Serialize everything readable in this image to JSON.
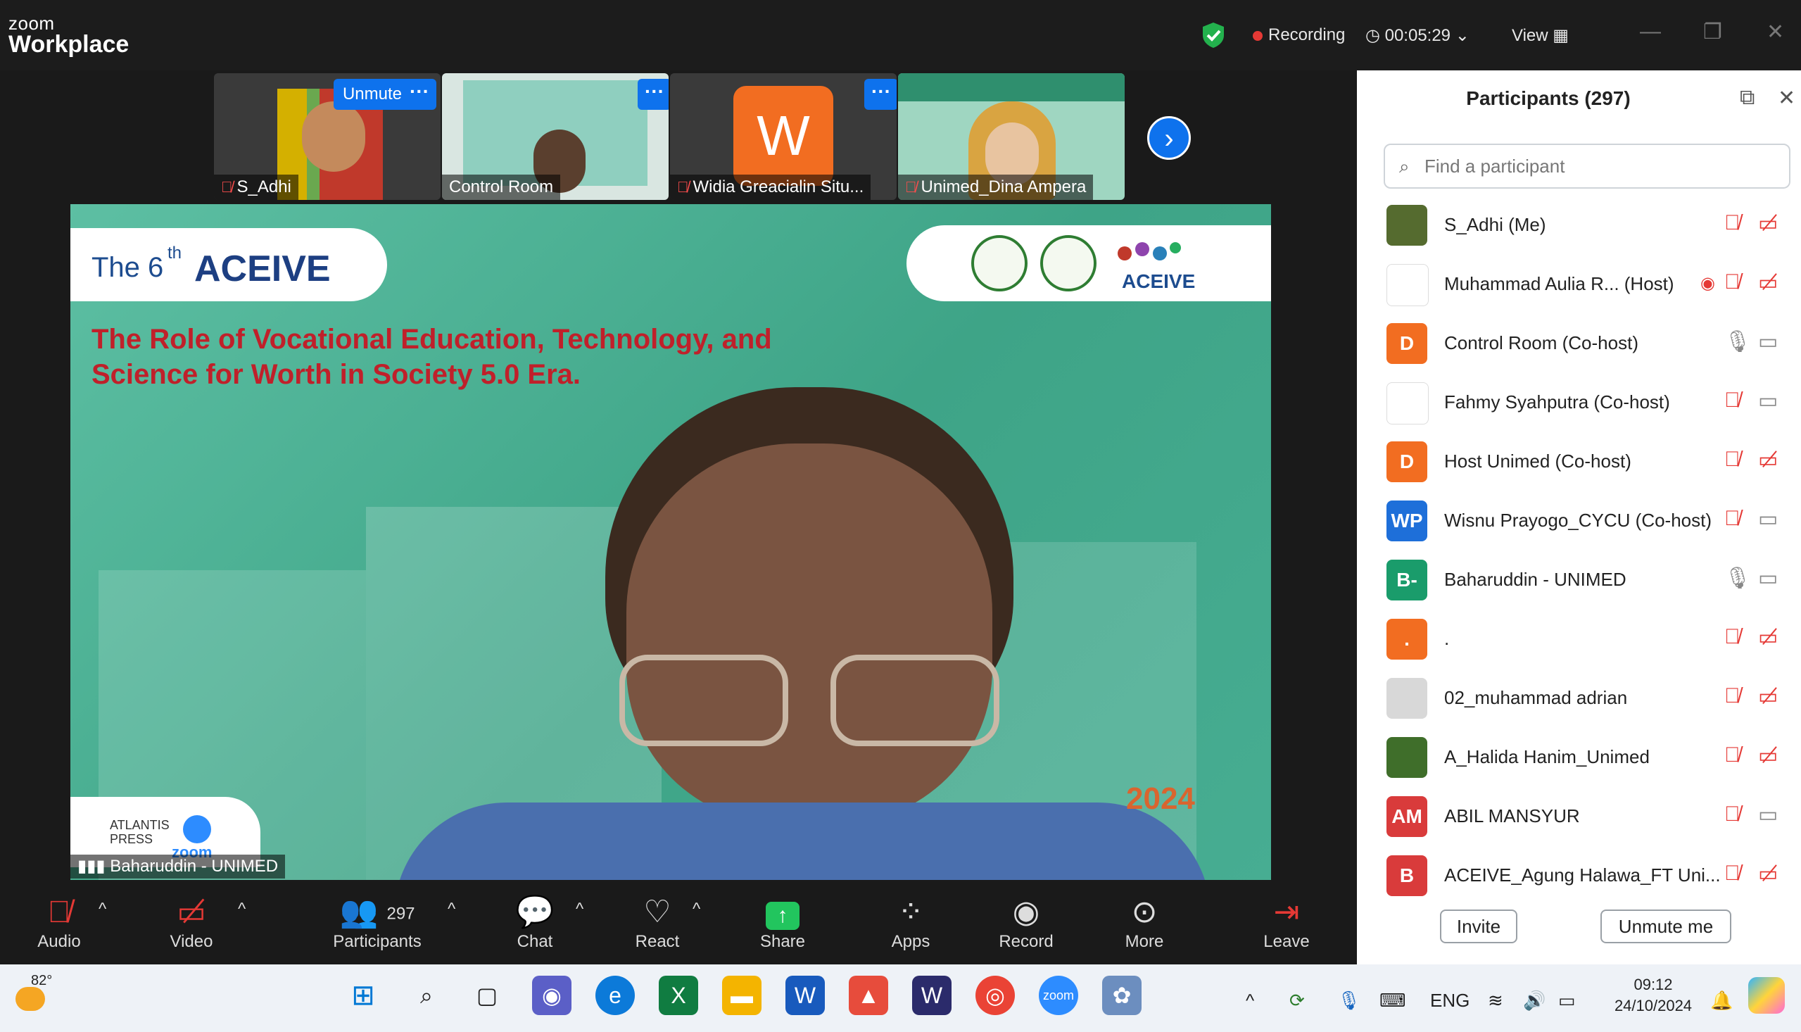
{
  "titlebar": {
    "logo_small": "zoom",
    "logo_big": "Workplace",
    "recording": "Recording",
    "timer": "00:05:29",
    "view": "View"
  },
  "thumbnails": [
    {
      "name": "S_Adhi",
      "unmute": "Unmute"
    },
    {
      "name": "Control Room"
    },
    {
      "name": "Widia Greacialin Situ...",
      "initial": "W"
    },
    {
      "name": "Unimed_Dina Ampera"
    }
  ],
  "more_glyph": "···",
  "slide": {
    "edition": "The 6",
    "edition_sup": "th",
    "brand": "ACEIVE",
    "title_line1": "The Role of Vocational Education, Technology, and",
    "title_line2": "Science for Worth in Society 5.0 Era.",
    "year": "2024",
    "sponsor1": "ATLANTIS PRESS",
    "sponsor2": "zoom"
  },
  "speaker_name": "Baharuddin - UNIMED",
  "toolbar": {
    "audio": "Audio",
    "video": "Video",
    "participants": "Participants",
    "participants_count": "297",
    "chat": "Chat",
    "react": "React",
    "share": "Share",
    "apps": "Apps",
    "record": "Record",
    "more": "More",
    "leave": "Leave"
  },
  "panel": {
    "title": "Participants (297)",
    "search_placeholder": "Find a participant",
    "invite": "Invite",
    "unmute_me": "Unmute me",
    "participants": [
      {
        "name": "S_Adhi (Me)",
        "avatar": "",
        "color": "#556b2f",
        "mic": "muted",
        "video": "off"
      },
      {
        "name": "Muhammad Aulia R...  (Host)",
        "avatar": "",
        "color": "#ffffff",
        "mic": "muted",
        "video": "off",
        "recording": true
      },
      {
        "name": "Control Room (Co-host)",
        "avatar": "D",
        "color": "#f26d21",
        "mic": "on",
        "video": "on"
      },
      {
        "name": "Fahmy Syahputra (Co-host)",
        "avatar": "",
        "color": "#ffffff",
        "mic": "muted",
        "video": "on"
      },
      {
        "name": "Host Unimed (Co-host)",
        "avatar": "D",
        "color": "#f26d21",
        "mic": "muted",
        "video": "off"
      },
      {
        "name": "Wisnu Prayogo_CYCU (Co-host)",
        "avatar": "WP",
        "color": "#1e6fd9",
        "mic": "muted",
        "video": "on"
      },
      {
        "name": "Baharuddin - UNIMED",
        "avatar": "B-",
        "color": "#1a9c6b",
        "mic": "on",
        "video": "on"
      },
      {
        "name": ".",
        "avatar": ".",
        "color": "#f26d21",
        "mic": "muted",
        "video": "off"
      },
      {
        "name": "02_muhammad adrian",
        "avatar": "",
        "color": "#d8d8d8",
        "mic": "muted",
        "video": "off"
      },
      {
        "name": "A_Halida Hanim_Unimed",
        "avatar": "",
        "color": "#3f6e2a",
        "mic": "muted",
        "video": "off"
      },
      {
        "name": "ABIL MANSYUR",
        "avatar": "AM",
        "color": "#d93b3b",
        "mic": "muted",
        "video": "on"
      },
      {
        "name": "ACEIVE_Agung Halawa_FT Uni...",
        "avatar": "B",
        "color": "#d93b3b",
        "mic": "muted",
        "video": "off"
      }
    ]
  },
  "taskbar": {
    "weather": "82°",
    "lang": "ENG",
    "time": "09:12",
    "date": "24/10/2024"
  },
  "colors": {
    "accent": "#0e72ed",
    "muted": "#e53935",
    "share": "#22c55e",
    "slide_bg": "#4cae96"
  }
}
